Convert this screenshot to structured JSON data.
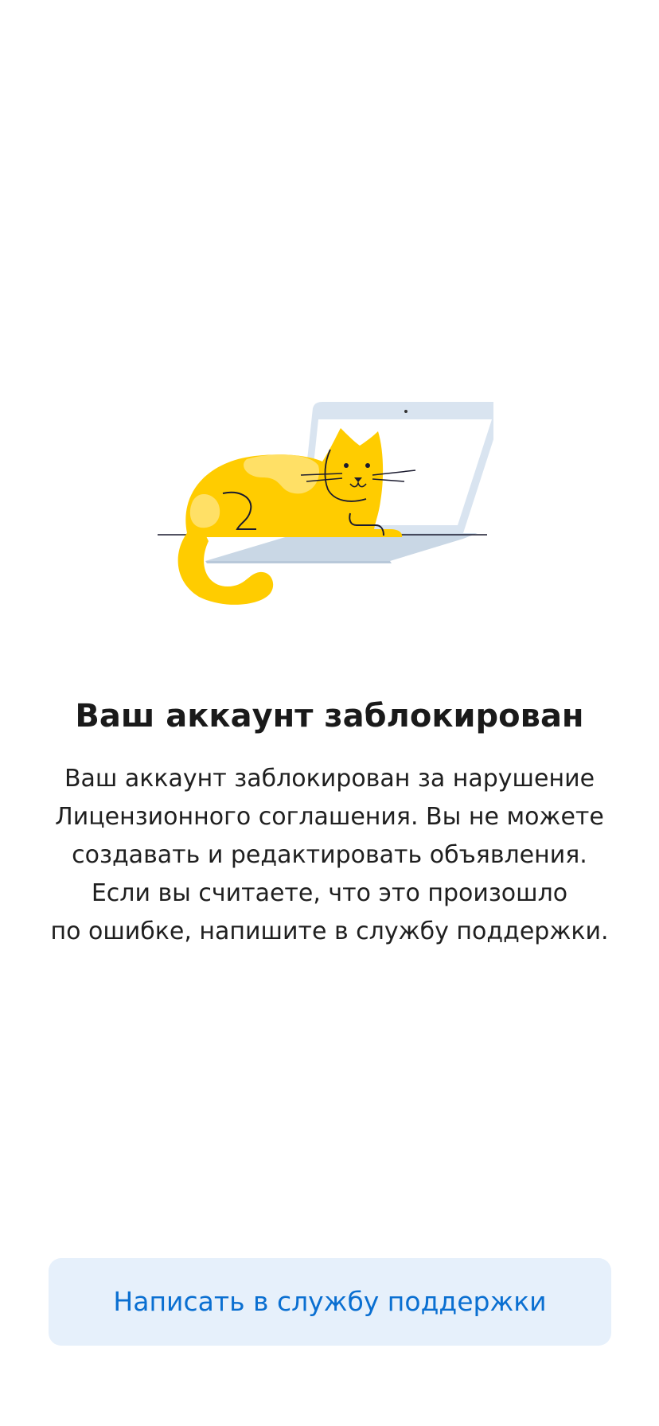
{
  "screen": {
    "title": "Ваш аккаунт заблокирован",
    "message_lines": [
      "Ваш аккаунт заблокирован за нарушение",
      "Лицензионного соглашения. Вы не можете",
      "создавать и редактировать объявления.",
      "Если вы считаете, что это произошло",
      "по ошибке, напишите в службу поддержки."
    ]
  },
  "illustration": {
    "icon": "cat-on-laptop-illustration",
    "cat_color": "#ffcc00",
    "laptop_color": "#d6e2ef"
  },
  "actions": {
    "support_label": "Написать в службу поддержки",
    "support_bg": "#e6f0fb",
    "support_text_color": "#0a6fd1"
  }
}
